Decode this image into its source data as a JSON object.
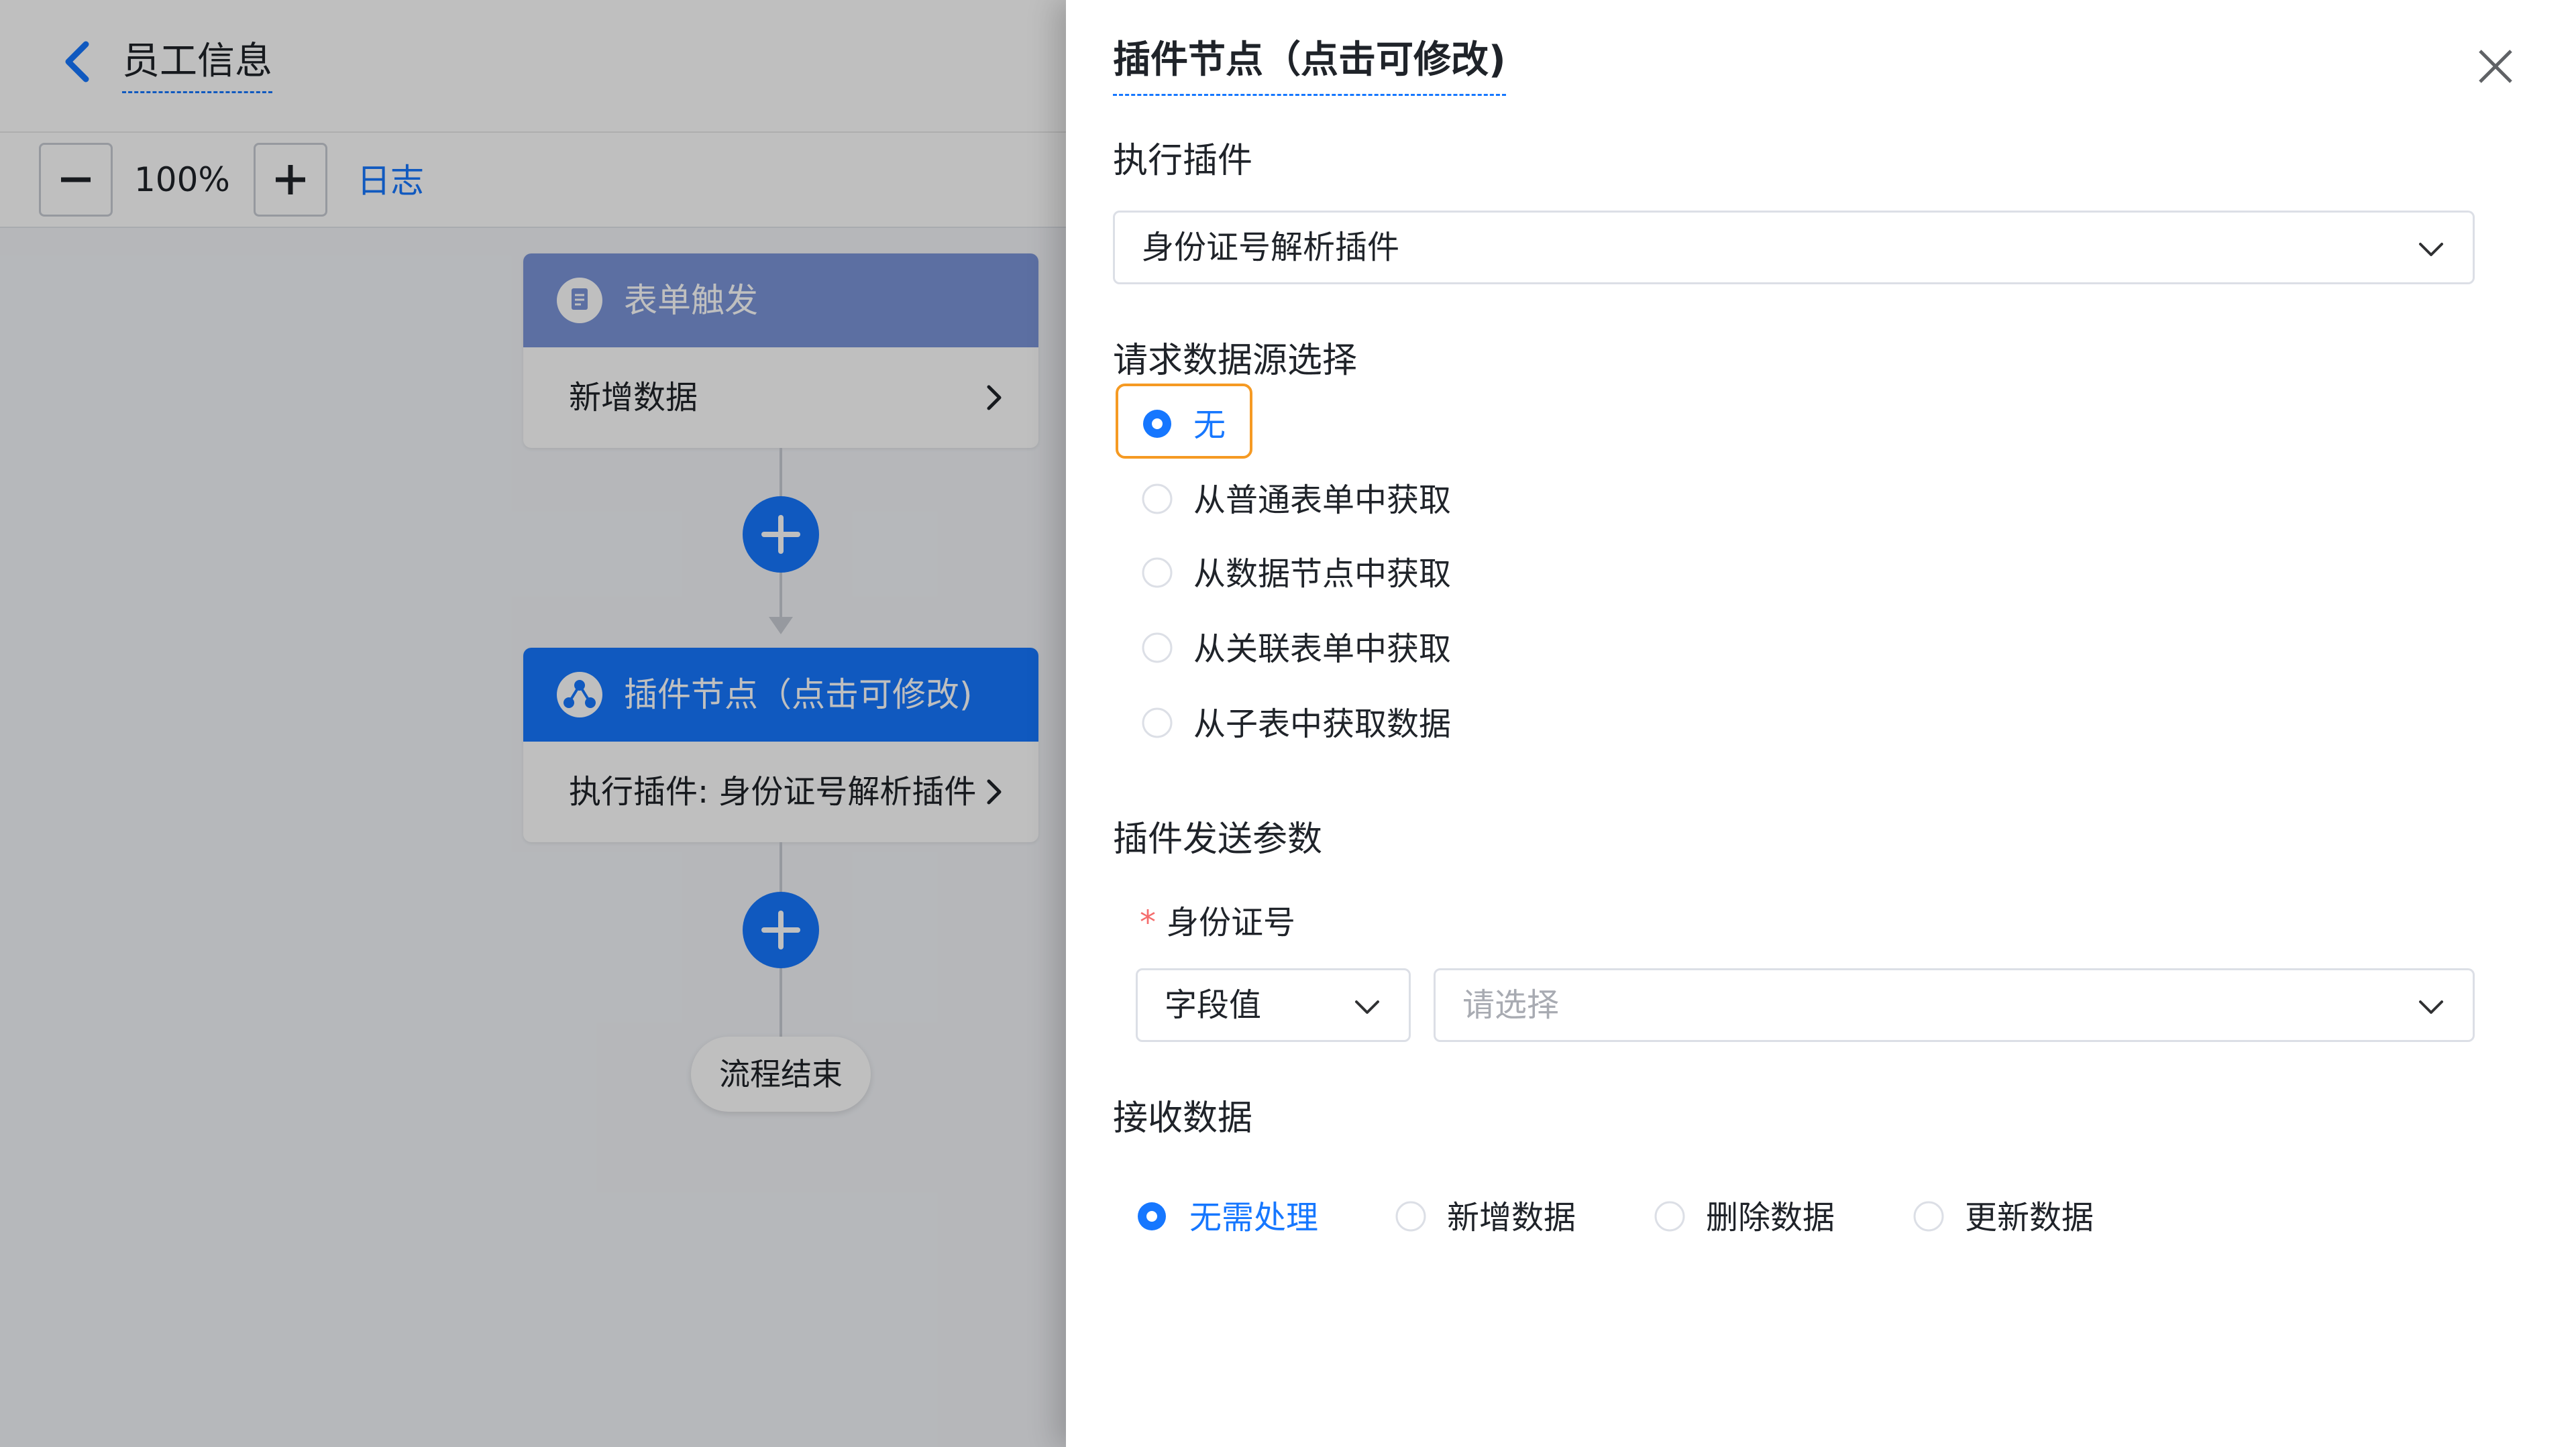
{
  "header": {
    "title": "员工信息"
  },
  "toolbar": {
    "zoom": "100%",
    "log_label": "日志"
  },
  "flow": {
    "trigger_node": {
      "title": "表单触发",
      "body": "新增数据"
    },
    "plugin_node": {
      "title": "插件节点（点击可修改)",
      "body": "执行插件: 身份证号解析插件"
    },
    "end_label": "流程结束"
  },
  "drawer": {
    "title": "插件节点（点击可修改)",
    "exec_plugin_label": "执行插件",
    "exec_plugin_value": "身份证号解析插件",
    "data_source_label": "请求数据源选择",
    "data_source_options": [
      "无",
      "从普通表单中获取",
      "从数据节点中获取",
      "从关联表单中获取",
      "从子表中获取数据"
    ],
    "data_source_selected": "无",
    "send_params_label": "插件发送参数",
    "id_field_label": "身份证号",
    "required_mark": "*",
    "field_type_value": "字段值",
    "field_value_placeholder": "请选择",
    "receive_label": "接收数据",
    "receive_options": [
      "无需处理",
      "新增数据",
      "删除数据",
      "更新数据"
    ],
    "receive_selected": "无需处理"
  },
  "colors": {
    "primary": "#1677ff",
    "trigger_header": "#7b95d9",
    "plugin_header": "#1677ff",
    "focus": "#f59a23"
  }
}
